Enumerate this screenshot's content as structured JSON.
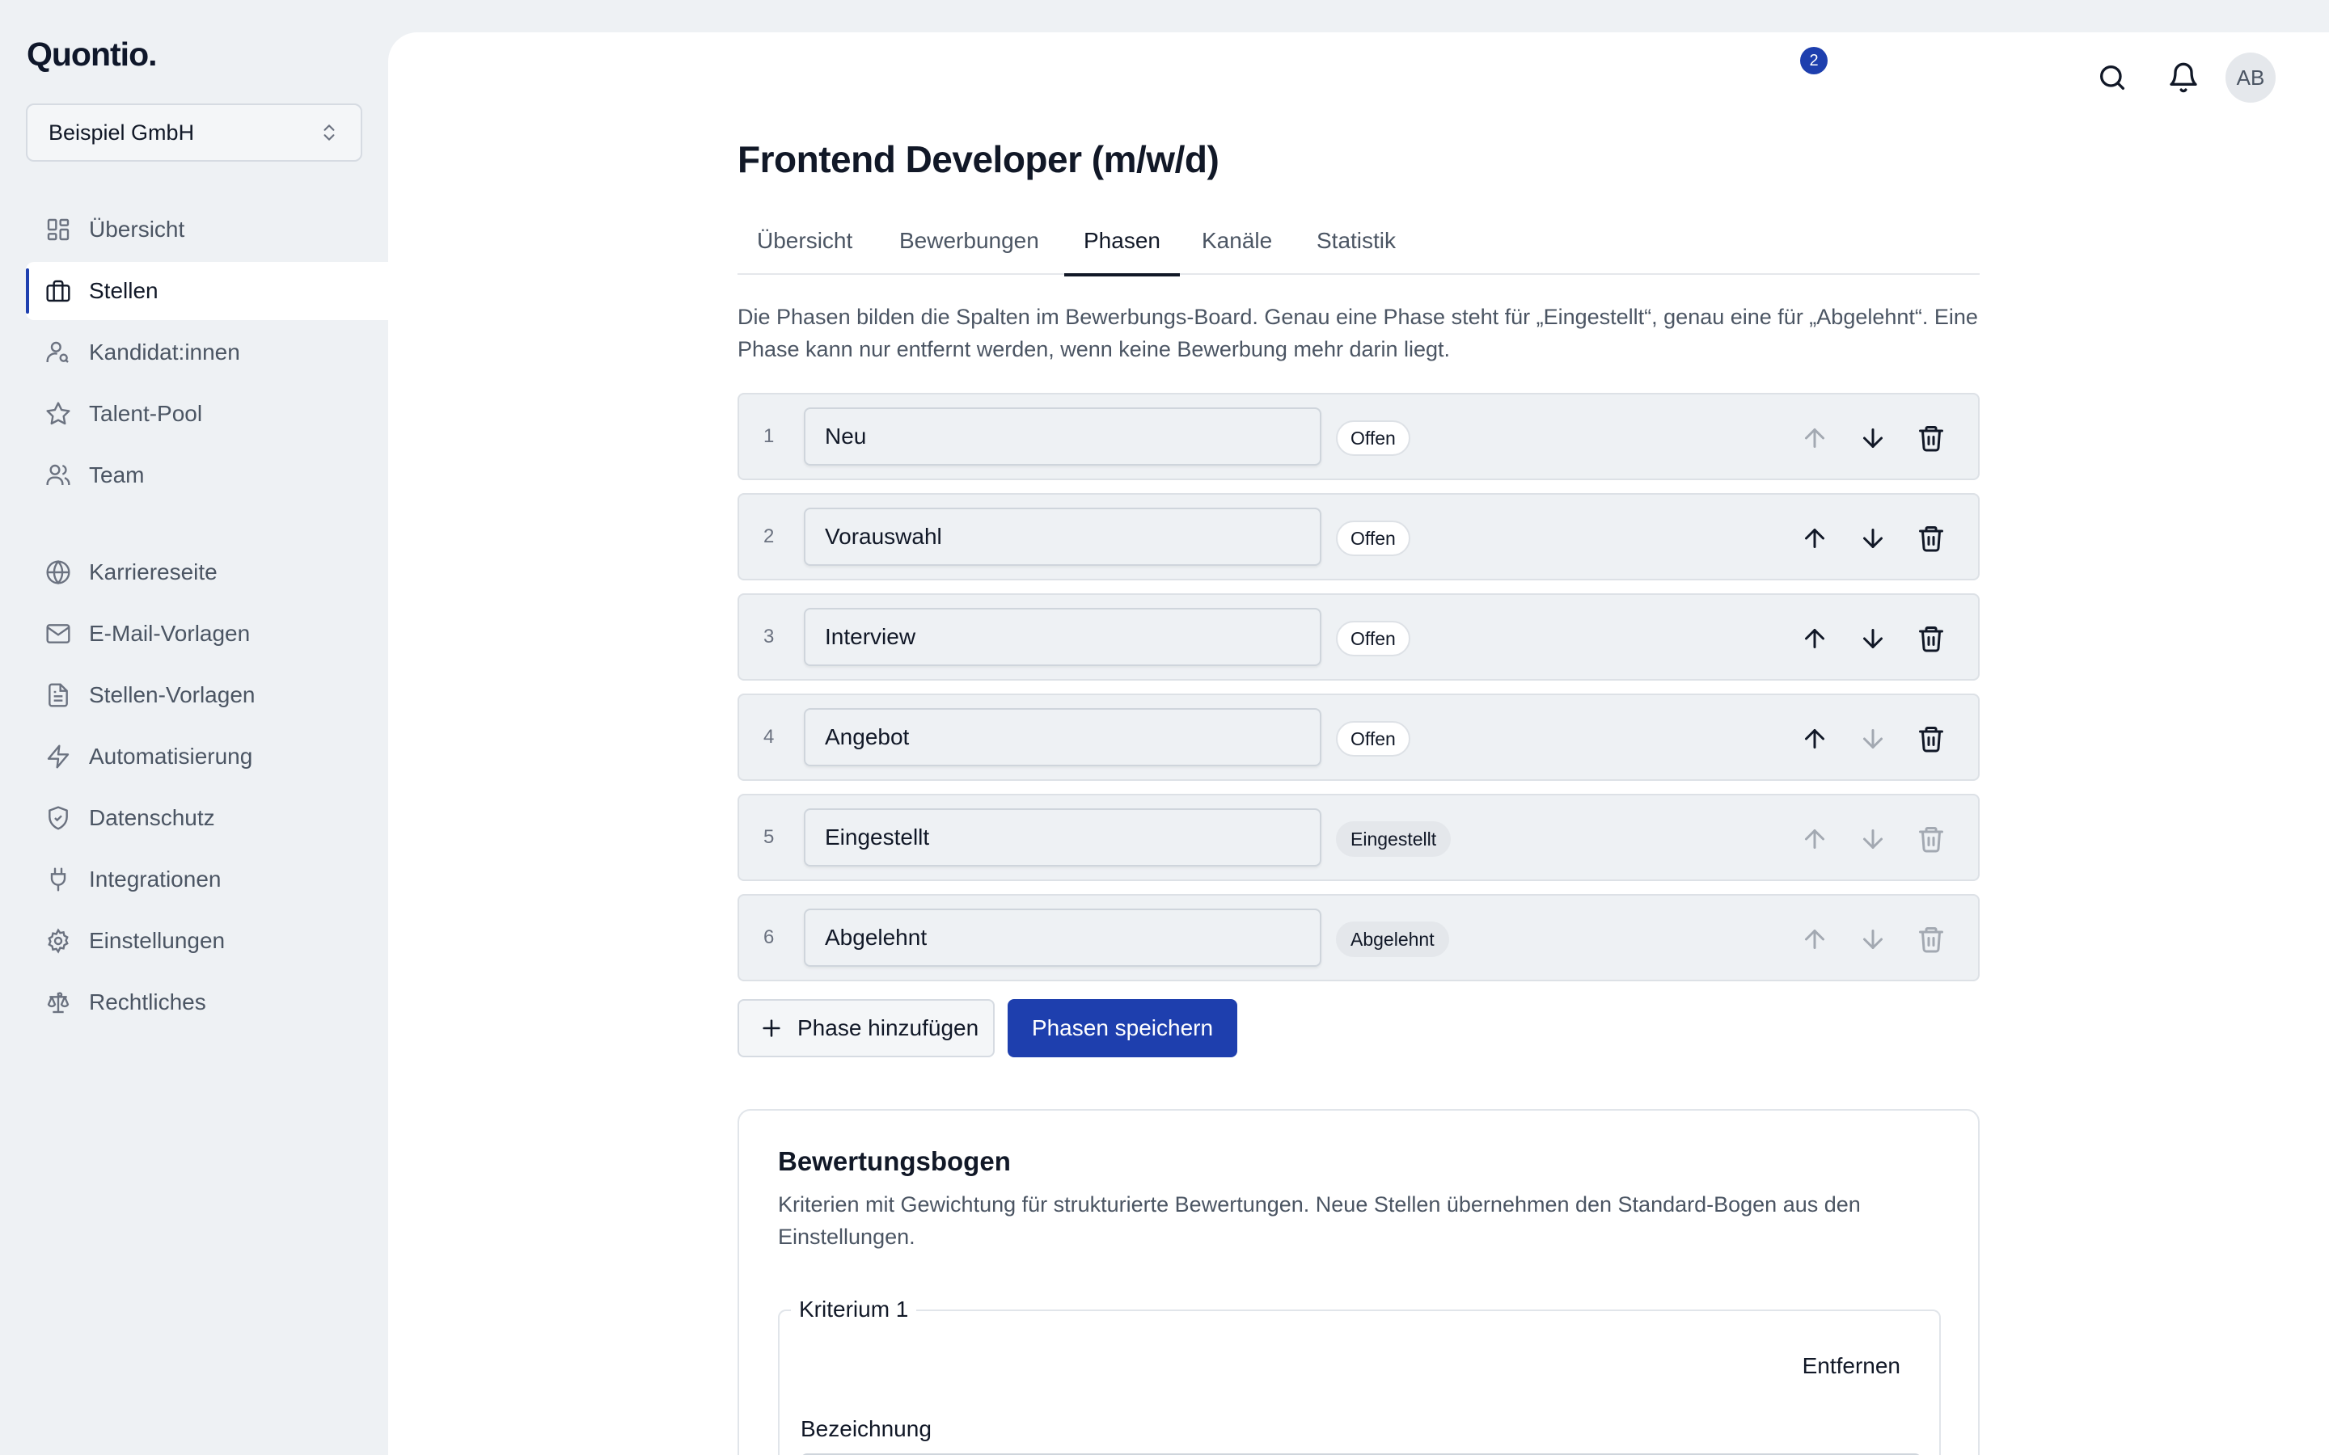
{
  "brand": {
    "logo": "Quontio."
  },
  "org_select": {
    "value": "Beispiel GmbH"
  },
  "sidebar": {
    "items": [
      {
        "label": "Übersicht",
        "icon": "dashboard-icon",
        "active": false
      },
      {
        "label": "Stellen",
        "icon": "briefcase-icon",
        "active": true
      },
      {
        "label": "Kandidat:innen",
        "icon": "user-search-icon",
        "active": false
      },
      {
        "label": "Talent-Pool",
        "icon": "star-icon",
        "active": false
      },
      {
        "label": "Team",
        "icon": "users-icon",
        "active": false
      },
      {
        "label": "Karriereseite",
        "icon": "globe-icon",
        "active": false
      },
      {
        "label": "E-Mail-Vorlagen",
        "icon": "mail-icon",
        "active": false
      },
      {
        "label": "Stellen-Vorlagen",
        "icon": "file-text-icon",
        "active": false
      },
      {
        "label": "Automatisierung",
        "icon": "zap-icon",
        "active": false
      },
      {
        "label": "Datenschutz",
        "icon": "shield-check-icon",
        "active": false
      },
      {
        "label": "Integrationen",
        "icon": "plug-icon",
        "active": false
      },
      {
        "label": "Einstellungen",
        "icon": "gear-icon",
        "active": false
      },
      {
        "label": "Rechtliches",
        "icon": "scale-icon",
        "active": false
      }
    ]
  },
  "topbar": {
    "notification_count": "2",
    "avatar_initials": "AB"
  },
  "page": {
    "title": "Frontend Developer (m/w/d)"
  },
  "tabs": [
    {
      "label": "Übersicht",
      "active": false
    },
    {
      "label": "Bewerbungen",
      "active": false
    },
    {
      "label": "Phasen",
      "active": true
    },
    {
      "label": "Kanäle",
      "active": false
    },
    {
      "label": "Statistik",
      "active": false
    }
  ],
  "intro_text": "Die Phasen bilden die Spalten im Bewerbungs-Board. Genau eine Phase steht für „Eingestellt“, genau eine für „Abgelehnt“. Eine Phase kann nur entfernt werden, wenn keine Bewerbung mehr darin liegt.",
  "phases": [
    {
      "number": "1",
      "name": "Neu",
      "badge": "Offen",
      "type": "open",
      "can_move_up": false,
      "can_move_down": true,
      "can_delete": true
    },
    {
      "number": "2",
      "name": "Vorauswahl",
      "badge": "Offen",
      "type": "open",
      "can_move_up": true,
      "can_move_down": true,
      "can_delete": true
    },
    {
      "number": "3",
      "name": "Interview",
      "badge": "Offen",
      "type": "open",
      "can_move_up": true,
      "can_move_down": true,
      "can_delete": true
    },
    {
      "number": "4",
      "name": "Angebot",
      "badge": "Offen",
      "type": "open",
      "can_move_up": true,
      "can_move_down": false,
      "can_delete": true
    },
    {
      "number": "5",
      "name": "Eingestellt",
      "badge": "Eingestellt",
      "type": "closed",
      "can_move_up": false,
      "can_move_down": false,
      "can_delete": false
    },
    {
      "number": "6",
      "name": "Abgelehnt",
      "badge": "Abgelehnt",
      "type": "closed",
      "can_move_up": false,
      "can_move_down": false,
      "can_delete": false
    }
  ],
  "actions": {
    "add_label": "Phase hinzufügen",
    "save_label": "Phasen speichern"
  },
  "scorecard": {
    "title": "Bewertungsbogen",
    "description": "Kriterien mit Gewichtung für strukturierte Bewertungen. Neue Stellen übernehmen den Standard-Bogen aus den Einstellungen.",
    "criterion_legend": "Kriterium 1",
    "remove_label": "Entfernen",
    "field_label": "Bezeichnung"
  },
  "colors": {
    "accent": "#1e3fae",
    "sidebar_bg": "#eef1f4",
    "active_indicator": "#1e40af"
  }
}
